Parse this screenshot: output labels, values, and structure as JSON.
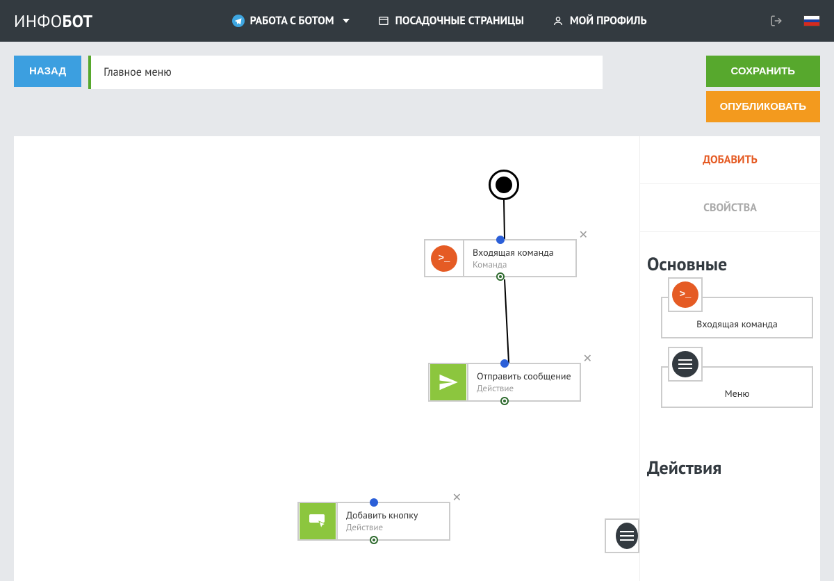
{
  "header": {
    "logo_thin": "ИНФО",
    "logo_bold": "БОТ",
    "nav": {
      "work_with_bot": "РАБОТА С БОТОМ",
      "landing_pages": "ПОСАДОЧНЫЕ СТРАНИЦЫ",
      "my_profile": "МОЙ ПРОФИЛЬ"
    }
  },
  "toolbar": {
    "back": "НАЗАД",
    "title": "Главное меню",
    "save": "СОХРАНИТЬ",
    "publish": "ОПУБЛИКОВАТЬ"
  },
  "sidebar": {
    "tab_add": "ДОБАВИТЬ",
    "tab_props": "СВОЙСТВА",
    "section_main": "Основные",
    "section_actions": "Действия",
    "items": {
      "incoming_command": "Входящая команда",
      "menu": "Меню"
    }
  },
  "nodes": {
    "n1": {
      "title": "Входящая команда",
      "sub": "Команда"
    },
    "n2": {
      "title": "Отправить сообщение",
      "sub": "Действие"
    },
    "n3": {
      "title": "Добавить кнопку",
      "sub": "Действие"
    }
  }
}
